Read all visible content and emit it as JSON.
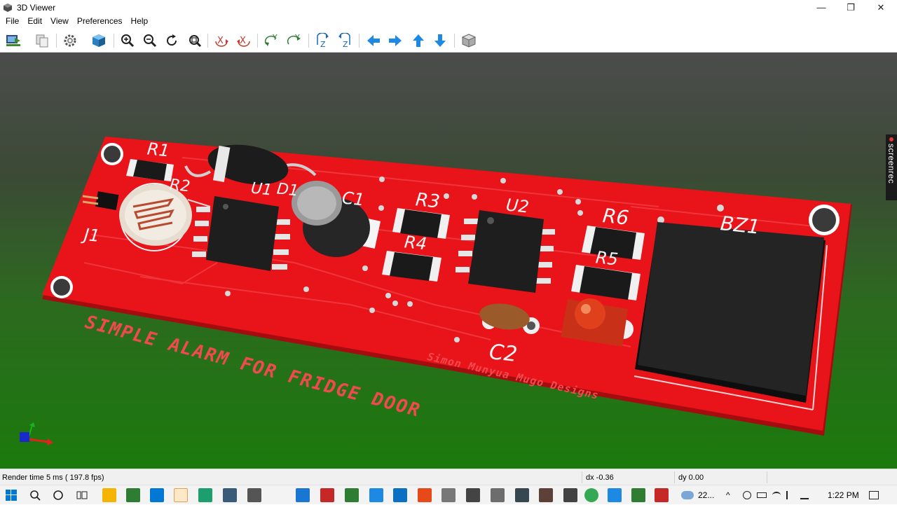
{
  "window": {
    "title": "3D Viewer",
    "controls": {
      "minimize": "—",
      "restore": "❐",
      "close": "✕"
    }
  },
  "menu": {
    "items": [
      "File",
      "Edit",
      "View",
      "Preferences",
      "Help"
    ]
  },
  "toolbar": {
    "buttons": [
      "export-image-icon",
      "copy-icon",
      "settings-icon",
      "render-mode-icon",
      "zoom-in-icon",
      "zoom-out-icon",
      "redraw-icon",
      "zoom-fit-icon",
      "rotate-x-cw-icon",
      "rotate-x-ccw-icon",
      "rotate-y-cw-icon",
      "rotate-y-ccw-icon",
      "rotate-z-cw-icon",
      "rotate-z-ccw-icon",
      "move-left-icon",
      "move-right-icon",
      "move-up-icon",
      "move-down-icon",
      "orthographic-icon"
    ]
  },
  "board": {
    "silkscreen_title": "SIMPLE ALARM FOR FRIDGE DOOR",
    "author": "Simon Munyua Mugo Designs",
    "designators": [
      "R1",
      "R2",
      "J1",
      "U1",
      "D1",
      "C1",
      "R3",
      "R4",
      "U2",
      "R6",
      "R5",
      "BZ1",
      "C2"
    ],
    "colors": {
      "pcb": "#e8141a",
      "pad": "#e6e6e6",
      "ic": "#1e1e1e",
      "led": "#d9391a"
    }
  },
  "overlay": {
    "screenrec_label": "screenrec"
  },
  "status": {
    "render_time": "Render time 5 ms ( 197.8 fps)",
    "dx": "dx -0.36",
    "dy": "dy 0.00"
  },
  "taskbar": {
    "weather": "22...",
    "time": "1:22 PM"
  }
}
